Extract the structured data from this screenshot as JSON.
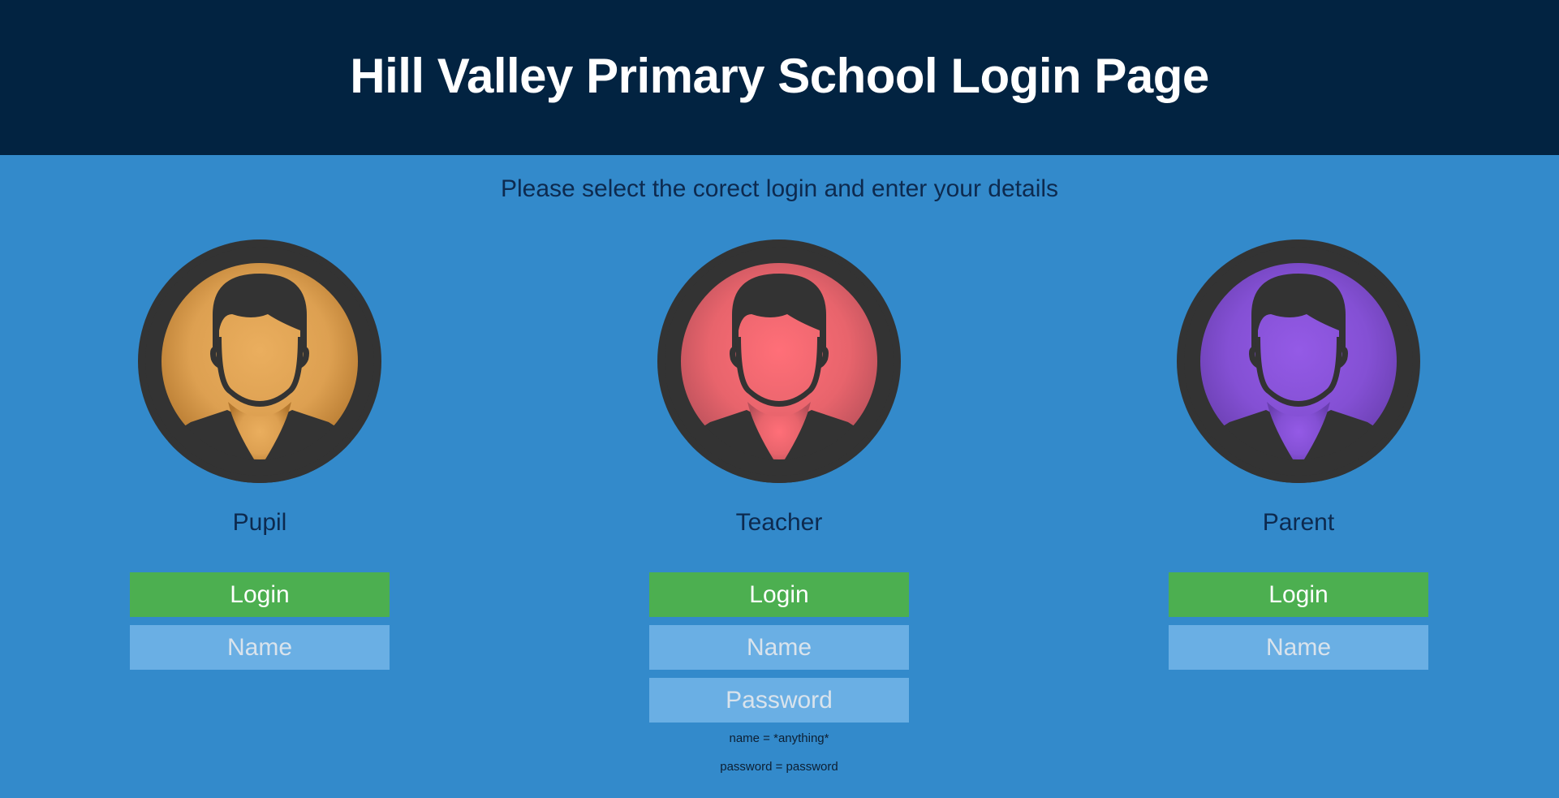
{
  "header": {
    "title": "Hill Valley Primary School Login Page"
  },
  "subtitle": "Please select the corect login and enter your details",
  "colors": {
    "header_bg": "#022341",
    "page_bg": "#338acb",
    "login_button": "#4caf50",
    "input_bg": "#6aafe4",
    "pupil_avatar": "#e8a95a",
    "teacher_avatar": "#f56a72",
    "parent_avatar": "#8f55e0"
  },
  "cards": {
    "pupil": {
      "role": "Pupil",
      "avatar_icon": "user-silhouette-icon",
      "login_label": "Login",
      "name_placeholder": "Name"
    },
    "teacher": {
      "role": "Teacher",
      "avatar_icon": "user-silhouette-icon",
      "login_label": "Login",
      "name_placeholder": "Name",
      "password_placeholder": "Password",
      "hint_name": "name = *anything*",
      "hint_password": "password = password"
    },
    "parent": {
      "role": "Parent",
      "avatar_icon": "user-silhouette-icon",
      "login_label": "Login",
      "name_placeholder": "Name"
    }
  }
}
